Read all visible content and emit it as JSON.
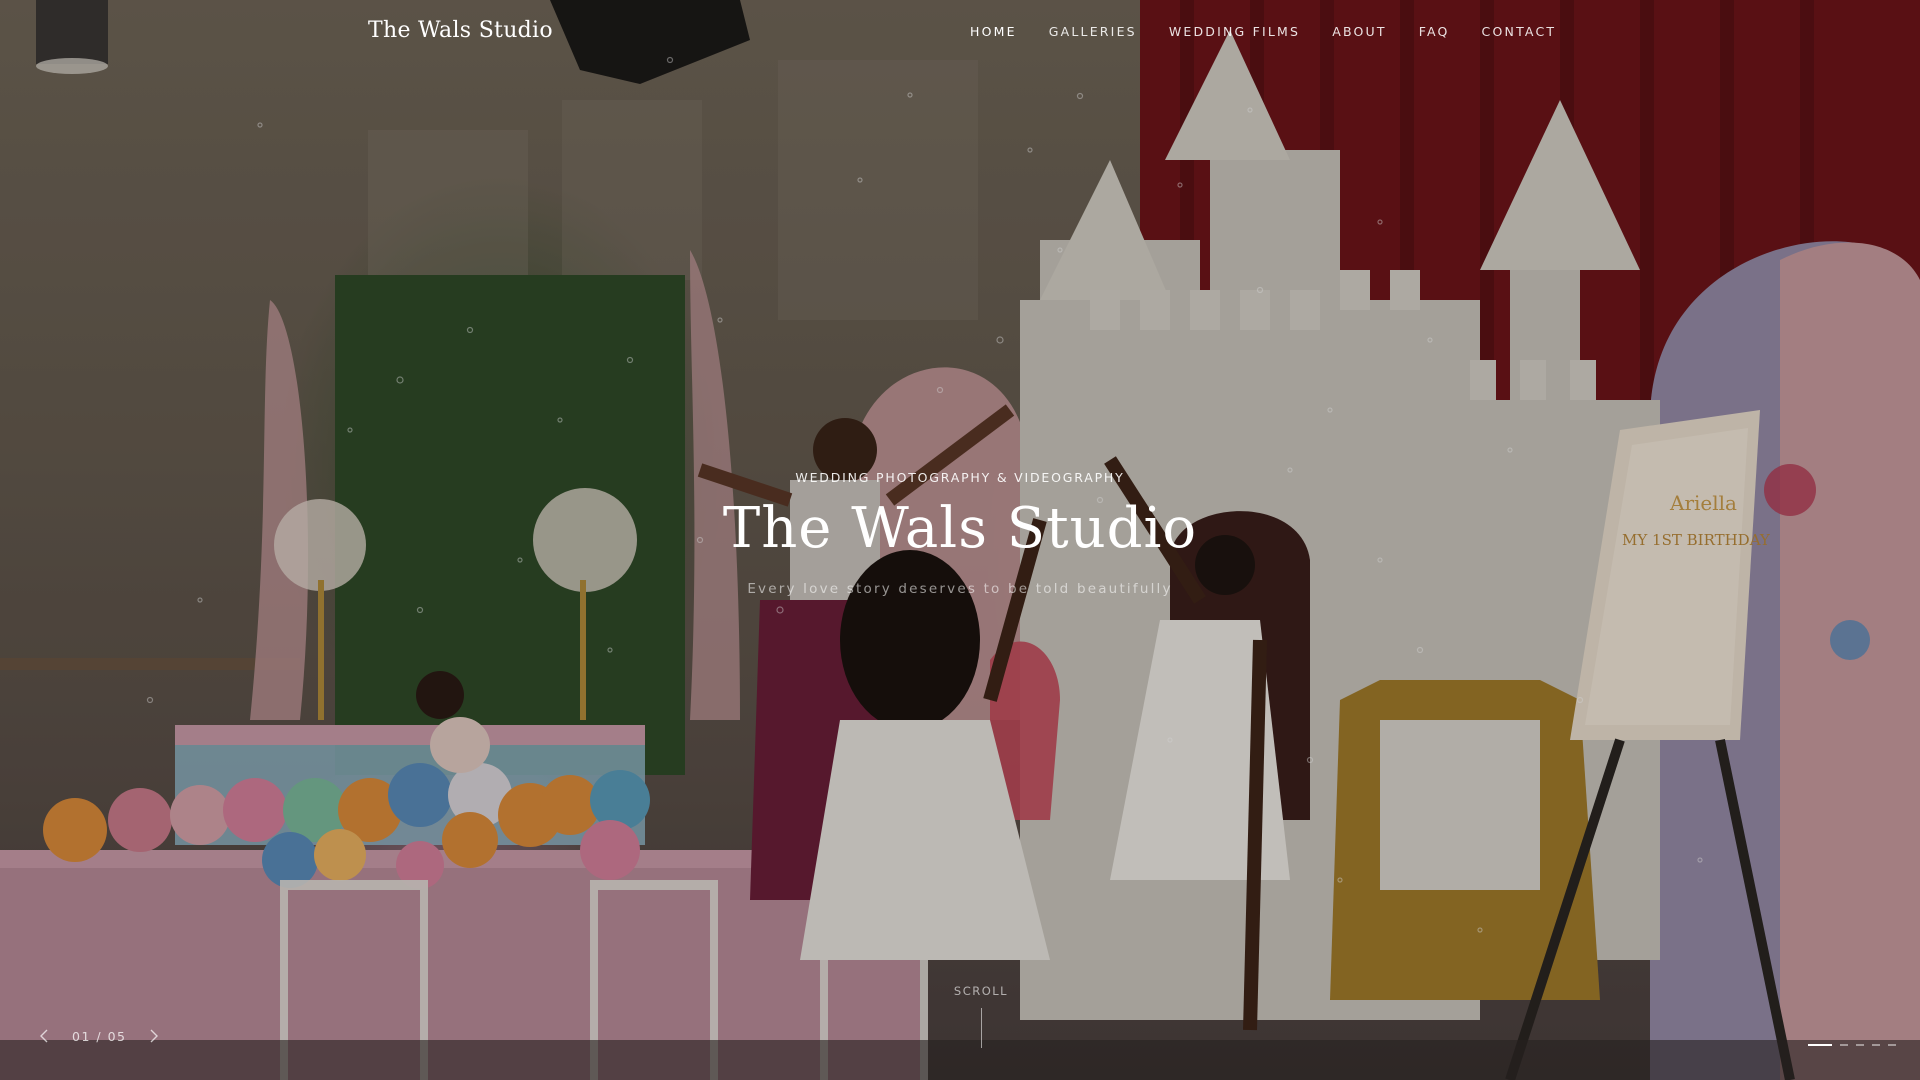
{
  "header": {
    "logo": "The Wals Studio",
    "nav": [
      {
        "label": "HOME"
      },
      {
        "label": "GALLERIES"
      },
      {
        "label": "WEDDING FILMS"
      },
      {
        "label": "ABOUT"
      },
      {
        "label": "FAQ"
      },
      {
        "label": "CONTACT"
      }
    ],
    "active_nav": "HOME"
  },
  "hero": {
    "eyebrow": "WEDDING PHOTOGRAPHY & VIDEOGRAPHY",
    "title": "The Wals Studio",
    "tagline": "Every love story deserves to be told beautifully",
    "scroll_label": "SCROLL"
  },
  "slider": {
    "counter": "01 / 05",
    "current": 1,
    "total": 5,
    "prev_icon": "chevron-left-icon",
    "next_icon": "chevron-right-icon"
  },
  "background_image": "photo of children playing with bubbles at a princess-themed first birthday party with a castle backdrop, balloons and a welcome sign",
  "sign": {
    "name": "Ariella",
    "text": "MY 1ST BIRTHDAY"
  },
  "colors": {
    "text": "#ffffff",
    "curtain": "#78141a",
    "greenery": "#2e4a26",
    "overlay": "rgba(0,0,0,0.18)"
  }
}
